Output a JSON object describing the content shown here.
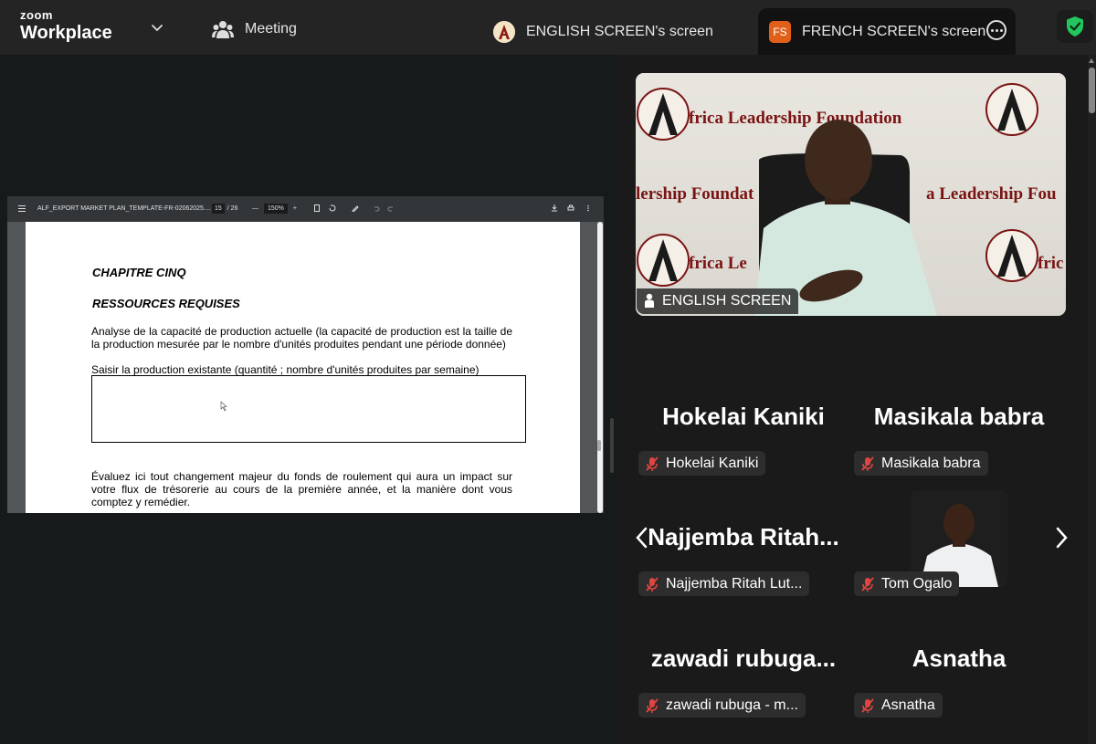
{
  "app": {
    "logo_top": "zoom",
    "logo_bottom": "Workplace"
  },
  "nav": {
    "meeting_label": "Meeting",
    "tabs": [
      {
        "label": "ENGLISH SCREEN's screen",
        "avatar": "A"
      },
      {
        "label": "FRENCH SCREEN's screen",
        "avatar": "FS"
      }
    ]
  },
  "colors": {
    "accent_shield": "#22c55e",
    "fs_avatar": "#e0601a",
    "mic_muted": "#e0453f"
  },
  "viewer": {
    "filename": "ALF_EXPORT MARKET PLAN_TEMPLATE-FR-02062025....",
    "page_current": "15",
    "page_total": "/ 26",
    "zoom": "150%",
    "document": {
      "heading1": "CHAPITRE CINQ",
      "heading2": "RESSOURCES REQUISES",
      "para1": "Analyse de la capacité de production actuelle (la capacité de production est la taille de la production mesurée par le nombre d'unités produites pendant une période donnée)",
      "para2": "Saisir la production existante (quantité ; nombre d'unités produites par semaine)",
      "para3": "Évaluez ici tout changement majeur du fonds de roulement qui aura un impact sur votre flux de trésorerie au cours de la première année, et la manière dont vous comptez y remédier."
    }
  },
  "video": {
    "speaker_name": "ENGLISH SCREEN",
    "backdrop_text_1": "frica Leadership Foundation",
    "backdrop_text_2": "lership Foundat",
    "backdrop_text_3": "a Leadership Fou",
    "backdrop_text_4": "frica Le",
    "backdrop_text_5": "fric"
  },
  "participants": [
    {
      "tile_name": "Hokelai Kaniki",
      "chip": "Hokelai Kaniki"
    },
    {
      "tile_name": "Masikala babra",
      "chip": "Masikala babra"
    },
    {
      "tile_name": "Najjemba  Ritah...",
      "chip": "Najjemba Ritah Lut..."
    },
    {
      "tile_name": "",
      "chip": "Tom Ogalo"
    },
    {
      "tile_name": "zawadi  rubuga...",
      "chip": "zawadi rubuga - m..."
    },
    {
      "tile_name": "Asnatha",
      "chip": "Asnatha"
    }
  ]
}
